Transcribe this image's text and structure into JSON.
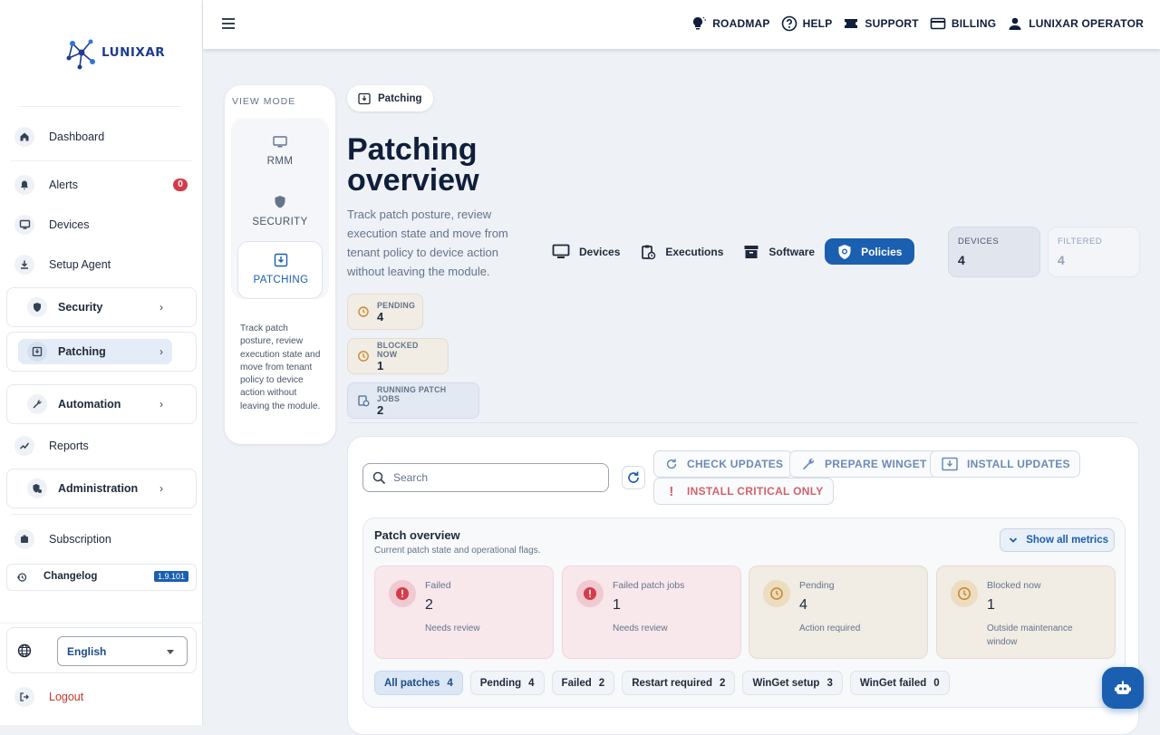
{
  "app": {
    "logo_text": "LUNIXAR"
  },
  "sidebar": {
    "items": [
      {
        "label": "Dashboard",
        "icon": "home-icon"
      },
      {
        "label": "Alerts",
        "icon": "bell-icon",
        "badge": "0"
      },
      {
        "label": "Devices",
        "icon": "monitor-icon"
      },
      {
        "label": "Setup Agent",
        "icon": "download-icon"
      },
      {
        "label": "Reports",
        "icon": "trend-icon"
      },
      {
        "label": "Subscription",
        "icon": "badge-icon"
      }
    ],
    "groups": [
      {
        "label": "Security",
        "icon": "shield-icon"
      },
      {
        "label": "Patching",
        "icon": "patch-icon",
        "active": true
      },
      {
        "label": "Automation",
        "icon": "wrench-icon"
      },
      {
        "label": "Administration",
        "icon": "admin-icon"
      }
    ],
    "changelog": {
      "label": "Changelog",
      "version": "1.9.101"
    },
    "language": {
      "value": "English"
    },
    "logout": "Logout"
  },
  "topbar": {
    "nav": [
      {
        "label": "ROADMAP",
        "icon": "lightbulb-icon"
      },
      {
        "label": "HELP",
        "icon": "help-icon"
      },
      {
        "label": "SUPPORT",
        "icon": "ticket-icon"
      },
      {
        "label": "BILLING",
        "icon": "card-icon"
      },
      {
        "label": "LUNIXAR OPERATOR",
        "icon": "user-icon"
      }
    ]
  },
  "view_mode": {
    "label": "VIEW MODE",
    "options": [
      {
        "label": "RMM"
      },
      {
        "label": "SECURITY"
      },
      {
        "label": "PATCHING",
        "active": true
      }
    ],
    "description": "Track patch posture, review execution state and move from tenant policy to device action without leaving the module."
  },
  "main": {
    "breadcrumb": "Patching",
    "title": "Patching overview",
    "subtitle": "Track patch posture, review execution state and move from tenant policy to device action without leaving the module.",
    "tabs": [
      {
        "label": "Devices"
      },
      {
        "label": "Executions"
      },
      {
        "label": "Software"
      },
      {
        "label": "Policies",
        "active": true
      }
    ],
    "stats": [
      {
        "label": "DEVICES",
        "value": "4"
      },
      {
        "label": "FILTERED",
        "value": "4"
      }
    ],
    "chips": [
      {
        "label": "PENDING",
        "value": "4"
      },
      {
        "label": "BLOCKED NOW",
        "value": "1"
      },
      {
        "label": "RUNNING PATCH JOBS",
        "value": "2"
      }
    ],
    "search_placeholder": "Search",
    "actions": [
      "CHECK UPDATES",
      "PREPARE WINGET",
      "INSTALL UPDATES",
      "INSTALL CRITICAL ONLY"
    ],
    "overview": {
      "title": "Patch overview",
      "subtitle": "Current patch state and operational flags.",
      "show_all": "Show all metrics",
      "metrics": [
        {
          "title": "Failed",
          "value": "2",
          "sub": "Needs review"
        },
        {
          "title": "Failed patch jobs",
          "value": "1",
          "sub": "Needs review"
        },
        {
          "title": "Pending",
          "value": "4",
          "sub": "Action required"
        },
        {
          "title": "Blocked now",
          "value": "1",
          "sub": "Outside maintenance window"
        }
      ],
      "filters": [
        {
          "label": "All patches",
          "count": "4"
        },
        {
          "label": "Pending",
          "count": "4"
        },
        {
          "label": "Failed",
          "count": "2"
        },
        {
          "label": "Restart required",
          "count": "2"
        },
        {
          "label": "WinGet setup",
          "count": "3"
        },
        {
          "label": "WinGet failed",
          "count": "0"
        }
      ]
    }
  },
  "colors": {
    "accent": "#1b5fb0",
    "danger": "#d43c4b",
    "warning": "#c98a2e"
  }
}
